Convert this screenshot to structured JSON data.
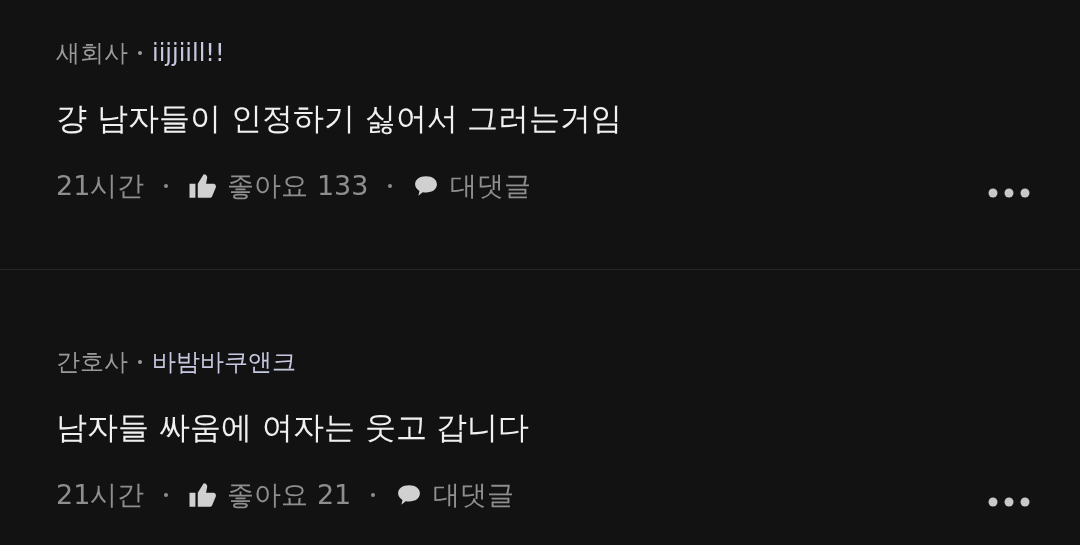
{
  "comments": [
    {
      "job": "새회사",
      "nickname": "iijjiill!!",
      "text": "걍 남자들이 인정하기 싫어서 그러는거임",
      "time": "21시간",
      "likes_label": "좋아요 133",
      "reply_label": "대댓글"
    },
    {
      "job": "간호사",
      "nickname": "바밤바쿠앤크",
      "text": "남자들 싸움에 여자는 웃고 갑니다",
      "time": "21시간",
      "likes_label": "좋아요 21",
      "reply_label": "대댓글"
    }
  ]
}
